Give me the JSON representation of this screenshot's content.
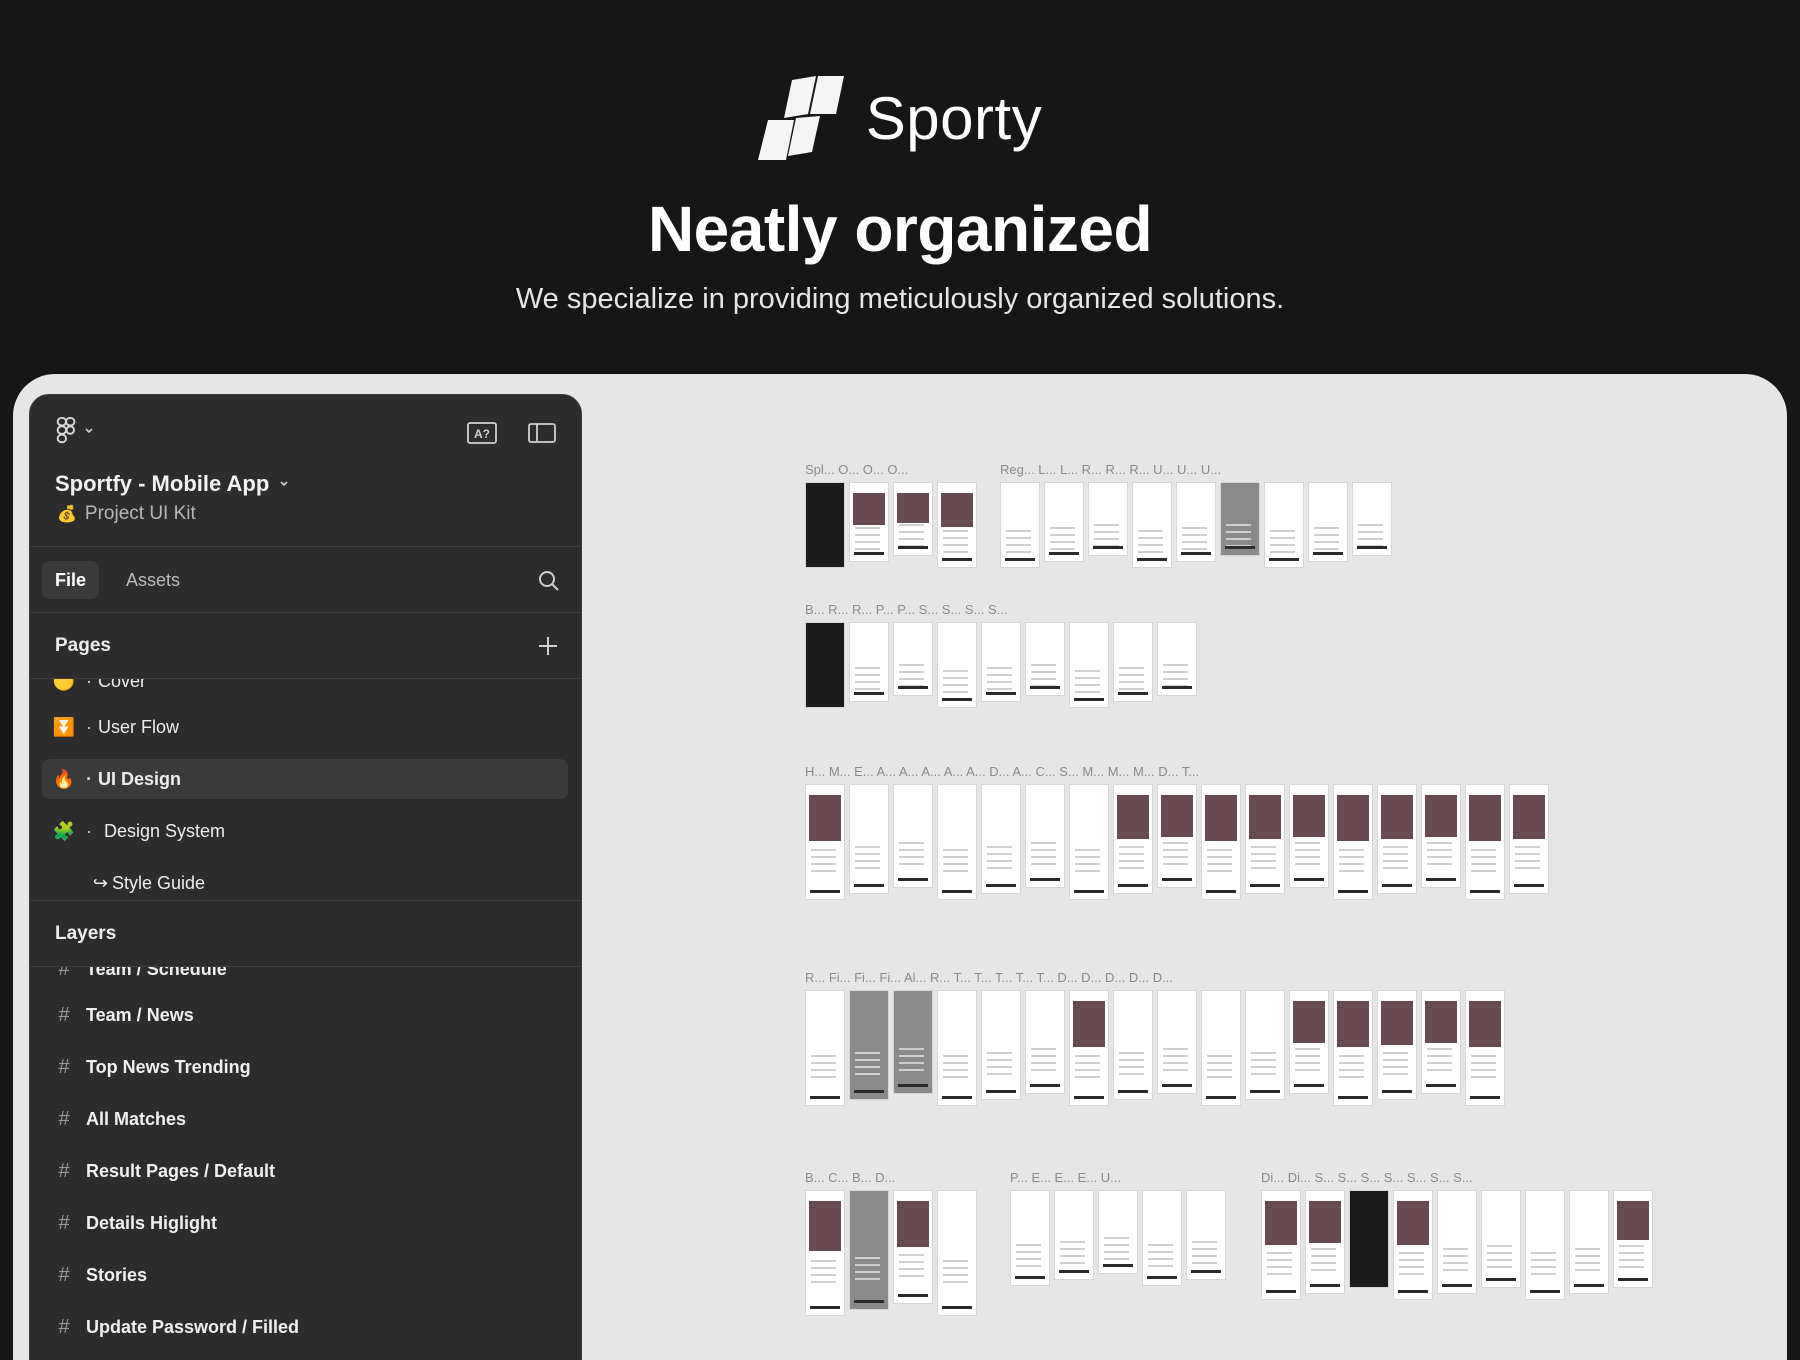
{
  "hero": {
    "brand_name": "Sporty",
    "headline": "Neatly organized",
    "subline": "We specialize in providing meticulously organized solutions."
  },
  "panel": {
    "file_title": "Sportfy - Mobile App",
    "project_label": "Project UI Kit",
    "project_icon": "money-bag",
    "tabs": {
      "file": "File",
      "assets": "Assets"
    },
    "pages_heading": "Pages",
    "pages": [
      {
        "icon": "yellow-circle",
        "label": "Cover",
        "selected": false
      },
      {
        "icon": "blue-down-arrow-box",
        "label": "User Flow",
        "selected": false
      },
      {
        "icon": "fire",
        "label": "UI Design",
        "selected": true
      },
      {
        "icon": "puzzle",
        "label": "Design System",
        "selected": false
      },
      {
        "icon": "return-arrow",
        "label": "Style Guide",
        "selected": false
      }
    ],
    "layers_heading": "Layers",
    "layers": [
      "Team / Schedule",
      "Team / News",
      "Top News Trending",
      "All Matches",
      "Result Pages / Default",
      "Details Higlight",
      "Stories",
      "Update Password / Filled"
    ]
  },
  "canvas": {
    "groups": [
      {
        "labels": "Spl... O... O... O...",
        "count": 4
      },
      {
        "labels": "Reg... L... L... R... R... R... U... U... U...",
        "count": 9
      },
      {
        "labels": "B... R... R... P... P... S... S... S... S...",
        "count": 9
      },
      {
        "labels": "H... M... E... A... A... A... A... A... D... A... C... S... M... M... M... D... T...",
        "count": 17
      },
      {
        "labels": "R... Fi... Fi... Fi... Al... R... T... T... T... T... T... D... D... D... D... D...",
        "count": 16
      },
      {
        "labels": "B... C... B... D...",
        "count": 4
      },
      {
        "labels": "P... E... E... E... U...",
        "count": 5
      },
      {
        "labels": "Di... Di... S... S... S... S... S... S... S...",
        "count": 9
      }
    ]
  }
}
